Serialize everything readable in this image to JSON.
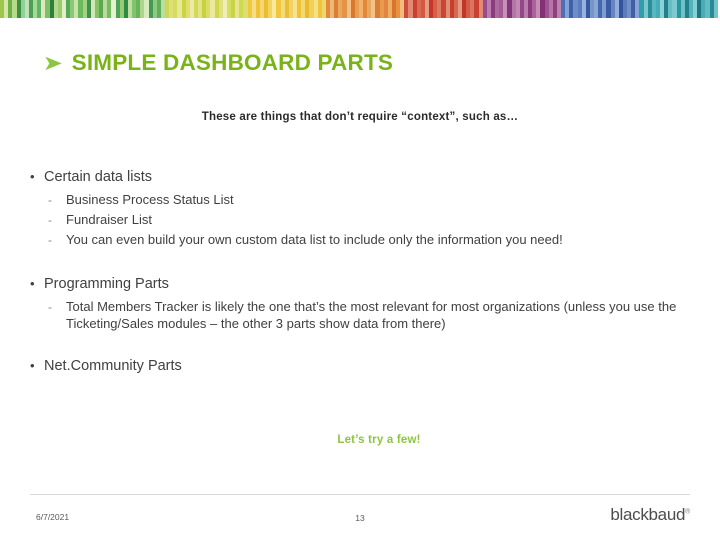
{
  "slide": {
    "title": "SIMPLE DASHBOARD PARTS",
    "title_arrow": "➤",
    "subtitle": "These are things that don’t require “context”, such as…",
    "closing_note": "Let’s try a few!",
    "sections": [
      {
        "heading": "Certain data lists",
        "items": [
          "Business Process Status List",
          "Fundraiser List",
          "You can even build your own custom data list to include only the information you need!"
        ]
      },
      {
        "heading": "Programming Parts",
        "items": [
          "Total Members Tracker is likely the one that’s the most relevant for most organizations (unless you use the Ticketing/Sales modules – the other 3 parts show data from there)"
        ]
      },
      {
        "heading": "Net.Community Parts",
        "items": []
      }
    ],
    "bullet_l1": "•",
    "bullet_l2": "-"
  },
  "footer": {
    "date": "6/7/2021",
    "page_number": "13",
    "brand": "blackbaud",
    "trademark": "®"
  },
  "colors": {
    "title_green": "#7ab317",
    "accent_green": "#8cc63e",
    "body_text": "#404040",
    "footer_text": "#595959"
  },
  "top_band_stripes": [
    "#9ec64b",
    "#d9e6a8",
    "#6fb04a",
    "#b7d98a",
    "#3f8f3f",
    "#8dd0a0",
    "#c3e1b0",
    "#49a05a",
    "#a7d98f",
    "#5fb36b",
    "#dce9b8",
    "#7cc06a",
    "#2f7d3f",
    "#b0d88e",
    "#9acb70",
    "#e2edc4",
    "#54a85c",
    "#8ac776",
    "#c8e3a6",
    "#6bb85e",
    "#a3d27f",
    "#3d9150",
    "#d2e8b4",
    "#87c265",
    "#5aa84f",
    "#bcd99c",
    "#74bb63",
    "#e7f0cf",
    "#4fa25a",
    "#97cb74",
    "#2e8b46",
    "#c0dda3",
    "#82c46b",
    "#66b55d",
    "#aed58b",
    "#d8ebbc",
    "#45995a",
    "#8fc97a",
    "#5eb05e",
    "#bfdc9f",
    "#cdd94f",
    "#e0e07a",
    "#d6dc5c",
    "#e8e79a",
    "#c9d63f",
    "#dedf6e",
    "#eceaa8",
    "#d2da55",
    "#e4e288",
    "#c5d43c",
    "#dbdd66",
    "#eae9a0",
    "#cfd84a",
    "#e1e07e",
    "#f0ecb6",
    "#d7dd60",
    "#c7d543",
    "#e6e48f",
    "#cdda52",
    "#ddde72",
    "#f0c93f",
    "#f6de86",
    "#eec33a",
    "#f4d86e",
    "#ecbd33",
    "#f3d45f",
    "#f8e79c",
    "#efc63c",
    "#f5db78",
    "#eabf35",
    "#f2d267",
    "#f7e290",
    "#edc238",
    "#f4d972",
    "#e8bb30",
    "#f1cf5b",
    "#f6e084",
    "#eec43e",
    "#f3d66a",
    "#e08a3c",
    "#eeb87a",
    "#dd7f33",
    "#e9a85f",
    "#e59446",
    "#f0c087",
    "#da7830",
    "#e79f52",
    "#efb36e",
    "#e2883a",
    "#eaa85f",
    "#f2c28b",
    "#dc7d35",
    "#e89b4c",
    "#e18541",
    "#edae68",
    "#d9742c",
    "#e5933f",
    "#f0bb7d",
    "#cf4b3a",
    "#e08a76",
    "#c9402f",
    "#d96a55",
    "#d45742",
    "#e69b84",
    "#c4372a",
    "#d5604a",
    "#dd7a62",
    "#cb4533",
    "#e08f78",
    "#c93e2c",
    "#d66752",
    "#e29a80",
    "#c13428",
    "#d25c47",
    "#db7460",
    "#c84131",
    "#df8a72",
    "#9c4a8e",
    "#bb7fae",
    "#8e3c80",
    "#ac6a9f",
    "#a45b96",
    "#c690b8",
    "#85357a",
    "#b374a6",
    "#c08bb3",
    "#95458a",
    "#b87fac",
    "#8b3a7e",
    "#a8639c",
    "#c48eb6",
    "#823274",
    "#9f5392",
    "#b577a8",
    "#8f3f82",
    "#bb84ae",
    "#4d6fb3",
    "#85a3d4",
    "#3f61a8",
    "#6f8ec7",
    "#5a7dbf",
    "#96b2dd",
    "#36589f",
    "#7795cb",
    "#8aa7d6",
    "#4668ad",
    "#7e9cd0",
    "#3a5ca3",
    "#6685c2",
    "#92aeda",
    "#33549a",
    "#5a7cbc",
    "#7391c8",
    "#415fa6",
    "#87a4d3",
    "#2f9ea8",
    "#79c8ce",
    "#2a8f99",
    "#5ab6bf",
    "#45adb6",
    "#8ad2d8",
    "#247f89",
    "#66bdc6",
    "#7ec9d0",
    "#2b95a0",
    "#6ec1c9",
    "#237f8a",
    "#54b2bb",
    "#86cfd5",
    "#1f7680",
    "#4aa9b3",
    "#63bcc4",
    "#2a8a95",
    "#72c4cb"
  ]
}
